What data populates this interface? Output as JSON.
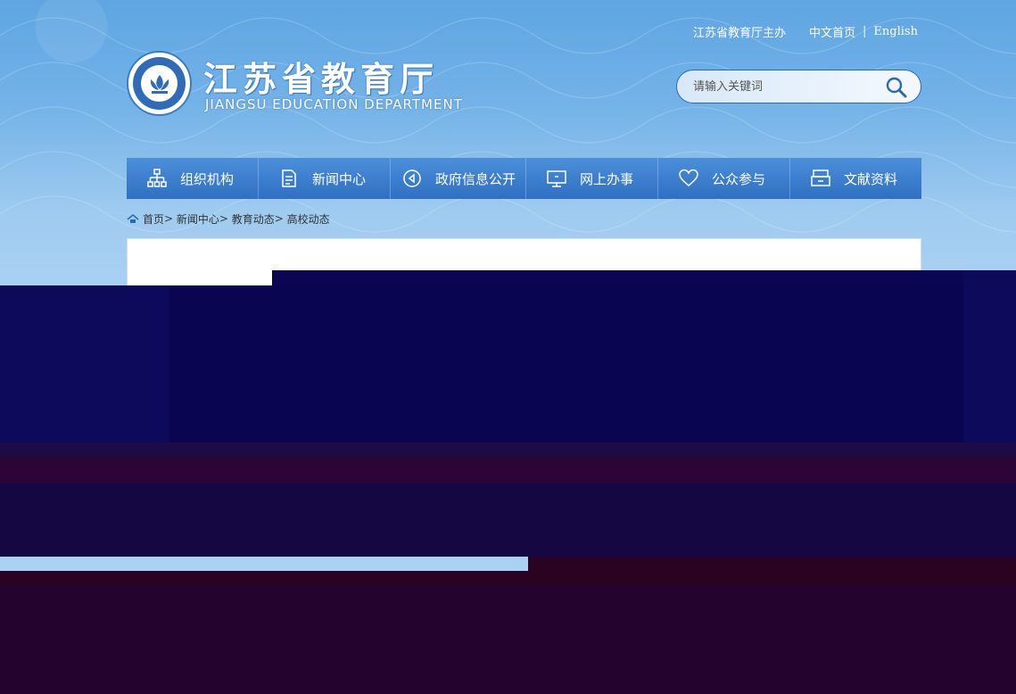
{
  "header": {
    "host_text": "江苏省教育厅主办",
    "home_link": "中文首页",
    "english_link": "English"
  },
  "logo": {
    "name_cn": "江苏省教育厅",
    "name_en": "JIANGSU EDUCATION DEPARTMENT"
  },
  "search": {
    "placeholder": "请输入关键词",
    "icon": "search-icon"
  },
  "nav": [
    {
      "label": "组织机构",
      "icon": "org-chart-icon"
    },
    {
      "label": "新闻中心",
      "icon": "document-icon"
    },
    {
      "label": "政府信息公开",
      "icon": "play-circle-icon"
    },
    {
      "label": "网上办事",
      "icon": "monitor-icon"
    },
    {
      "label": "公众参与",
      "icon": "heart-icon"
    },
    {
      "label": "文献资料",
      "icon": "archive-icon"
    }
  ],
  "breadcrumb": {
    "icon": "home-icon",
    "items": [
      "首页",
      "新闻中心",
      "教育动态",
      "高校动态"
    ]
  },
  "colors": {
    "nav_bg": "#3a7fd0",
    "glitch_navy": "#0b0654",
    "glitch_purple": "#2a0535"
  }
}
